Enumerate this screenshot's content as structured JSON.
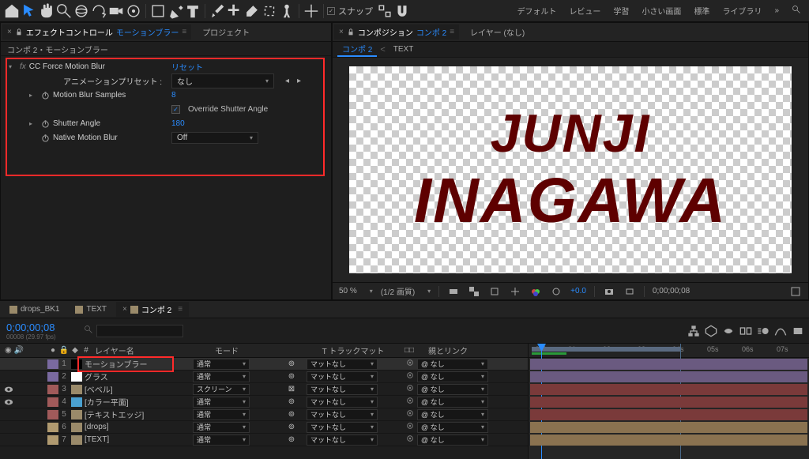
{
  "topbar": {
    "snap_label": "スナップ",
    "workspaces": [
      "デフォルト",
      "レビュー",
      "学習",
      "小さい画面",
      "標準",
      "ライブラリ"
    ]
  },
  "effects_panel": {
    "tab_prefix": "エフェクトコントロール",
    "tab_layer": "モーションブラー",
    "other_tab": "プロジェクト",
    "subtitle": "コンポ 2・モーションブラー",
    "fx_name": "CC Force Motion Blur",
    "reset_label": "リセット",
    "preset_label": "アニメーションプリセット :",
    "preset_value": "なし",
    "params": {
      "samples_label": "Motion Blur Samples",
      "samples_value": "8",
      "override_label": "Override Shutter Angle",
      "shutter_label": "Shutter Angle",
      "shutter_value": "180",
      "native_label": "Native Motion Blur",
      "native_value": "Off"
    }
  },
  "comp_panel": {
    "tab_prefix": "コンポジション",
    "tab_comp": "コンポ 2",
    "other_tab": "レイヤー (なし)",
    "subtabs": [
      "コンポ 2",
      "TEXT"
    ],
    "preview_line1": "JUNJI",
    "preview_line2": "INAGAWA",
    "footer": {
      "zoom": "50 %",
      "res": "(1/2 画質)",
      "exposure": "+0.0",
      "timecode": "0;00;00;08"
    }
  },
  "timeline": {
    "tabs": [
      "drops_BK1",
      "TEXT",
      "コンポ 2"
    ],
    "active_tab": 2,
    "timecode": "0;00;00;08",
    "frame_info": "00008 (29.97 fps)",
    "search_placeholder": "",
    "headers": {
      "layer_name": "レイヤー名",
      "mode": "モード",
      "trackmat": "T トラックマット",
      "parent": "親とリンク"
    },
    "mode_normal": "通常",
    "mode_screen": "スクリーン",
    "mat_none": "マットなし",
    "parent_none": "なし",
    "parent_at": "@",
    "layers": [
      {
        "num": "1",
        "color": "#7a6aa0",
        "ico": "#000",
        "name": "モーションブラー",
        "mode": "通常",
        "sel": true
      },
      {
        "num": "2",
        "color": "#7a6aa0",
        "ico": "#fff",
        "name": "グラス",
        "mode": "通常"
      },
      {
        "num": "3",
        "color": "#a05a5a",
        "ico": "comp",
        "name": "[ベベル]",
        "mode": "スクリーン",
        "eye": true
      },
      {
        "num": "4",
        "color": "#a05a5a",
        "ico": "#4aa0d0",
        "name": "[カラー平面]",
        "mode": "通常",
        "eye": true
      },
      {
        "num": "5",
        "color": "#a05a5a",
        "ico": "comp",
        "name": "[テキストエッジ]",
        "mode": "通常"
      },
      {
        "num": "6",
        "color": "#b09a70",
        "ico": "comp",
        "name": "[drops]",
        "mode": "通常"
      },
      {
        "num": "7",
        "color": "#b09a70",
        "ico": "comp",
        "name": "[TEXT]",
        "mode": "通常"
      }
    ],
    "ruler": [
      ":00f",
      "01s",
      "02s",
      "03s",
      "04s",
      "05s",
      "06s",
      "07s"
    ]
  }
}
